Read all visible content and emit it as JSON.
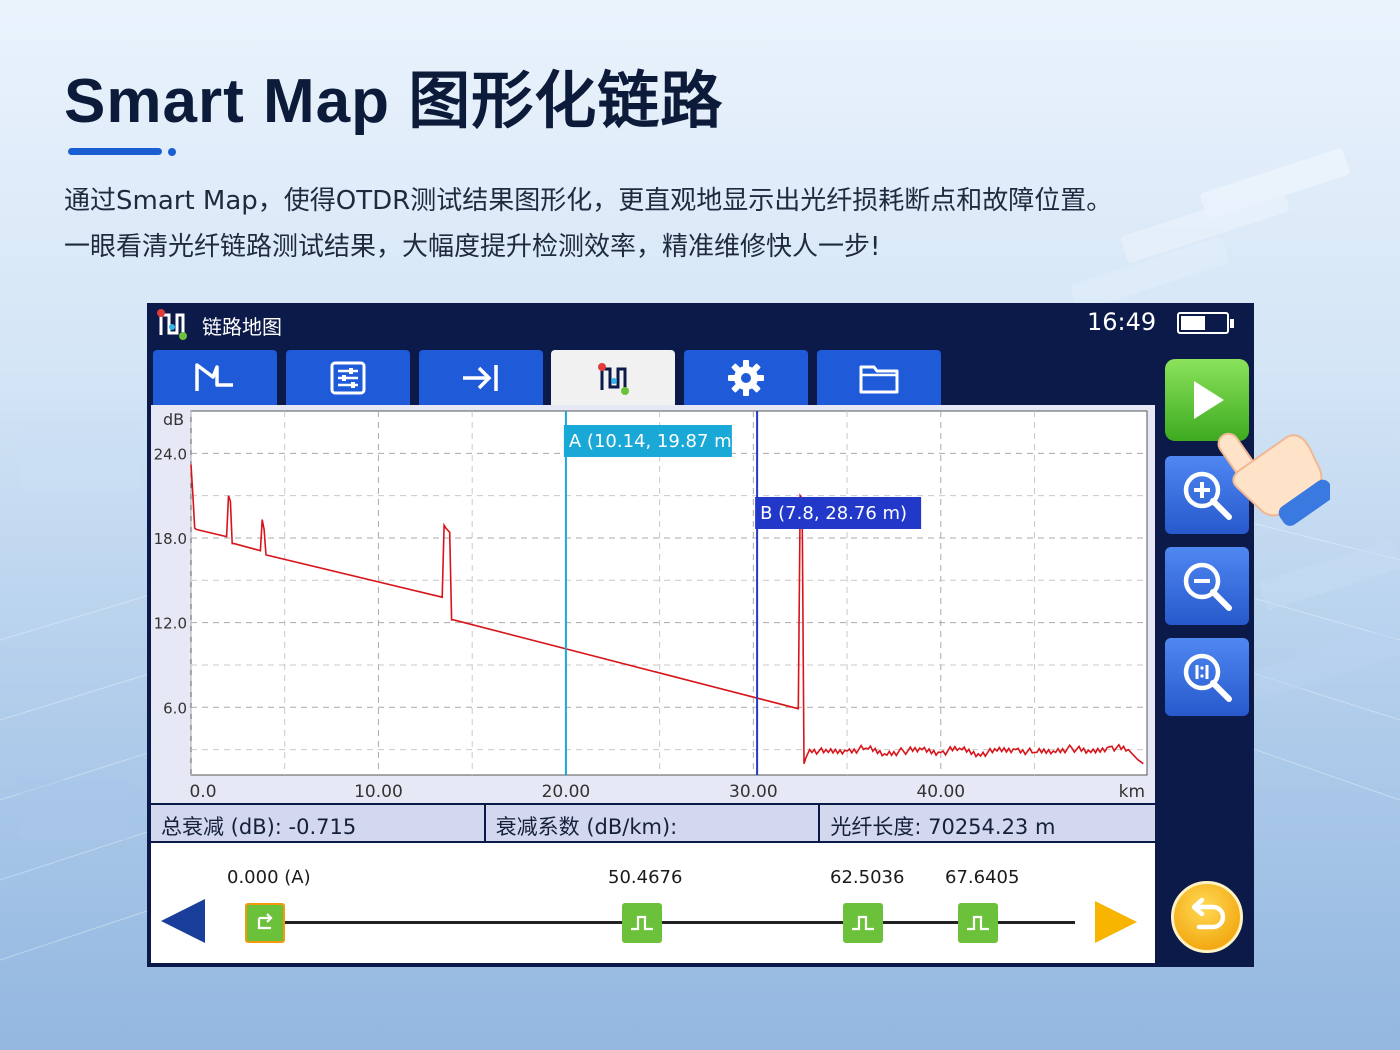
{
  "headline": "Smart Map 图形化链路",
  "description": {
    "line1": "通过Smart Map，使得OTDR测试结果图形化，更直观地显示出光纤损耗断点和故障位置。",
    "line2": "一眼看清光纤链路测试结果，大幅度提升检测效率，精准维修快人一步!"
  },
  "status_bar": {
    "app_title": "链路地图",
    "time": "16:49",
    "battery_level": 0.55
  },
  "tabs": [
    {
      "icon": "trace-icon",
      "active": false
    },
    {
      "icon": "parameters-icon",
      "active": false
    },
    {
      "icon": "go-to-end-icon",
      "active": false
    },
    {
      "icon": "link-map-icon",
      "active": true
    },
    {
      "icon": "settings-icon",
      "active": false
    },
    {
      "icon": "folder-icon",
      "active": false
    }
  ],
  "chart_data": {
    "type": "line",
    "ylabel": "dB",
    "xunit": "km",
    "xlim": [
      0,
      51
    ],
    "ylim": [
      1.2,
      27.0
    ],
    "yticks": [
      "24.0",
      "18.0",
      "12.0",
      "6.0"
    ],
    "xticks": [
      "0.0",
      "10.00",
      "20.00",
      "30.00",
      "40.00"
    ],
    "grid": true,
    "series": [
      {
        "color": "#d7141a",
        "x": [
          0.0,
          0.1,
          0.2,
          0.3,
          1.9,
          2.0,
          2.1,
          2.2,
          2.3,
          3.7,
          3.8,
          3.9,
          4.0,
          13.4,
          13.5,
          13.6,
          13.8,
          13.9,
          14.0,
          32.4,
          32.5,
          32.6,
          32.7,
          32.8,
          33.0,
          34.0,
          35.0,
          36.0,
          37.0,
          38.0,
          39.0,
          40.0,
          41.0,
          42.0,
          43.0,
          44.0,
          45.0,
          46.0,
          47.0,
          48.0,
          49.0,
          50.0,
          50.5,
          50.8
        ],
        "y": [
          23.2,
          21.0,
          18.7,
          18.6,
          18.1,
          21.0,
          20.6,
          17.6,
          17.6,
          17.1,
          19.3,
          18.6,
          16.8,
          13.8,
          18.9,
          18.7,
          18.4,
          12.2,
          12.2,
          5.9,
          21.0,
          20.8,
          2.0,
          2.4,
          3.0,
          2.8,
          2.9,
          3.1,
          2.7,
          2.9,
          3.0,
          2.8,
          3.1,
          2.7,
          2.9,
          3.0,
          2.8,
          2.9,
          3.1,
          2.8,
          3.2,
          3.0,
          2.3,
          2.0
        ]
      }
    ],
    "cursors": [
      {
        "name": "A",
        "label": "A (10.14, 19.87 m)",
        "x": 20.0,
        "color": "#1aa8d6"
      },
      {
        "name": "B",
        "label": "B (7.8, 28.76 m)",
        "x": 30.2,
        "color": "#2238c8"
      }
    ]
  },
  "results": {
    "total_loss": "总衰减 (dB): -0.715",
    "attenuation": "衰减系数 (dB/km):",
    "fiber_length": "光纤长度: 70254.23 m"
  },
  "link_map": {
    "events": [
      {
        "label": "0.000 (A)",
        "type": "start"
      },
      {
        "label": "50.4676",
        "type": "event"
      },
      {
        "label": "62.5036",
        "type": "event"
      },
      {
        "label": "67.6405",
        "type": "event"
      }
    ]
  }
}
